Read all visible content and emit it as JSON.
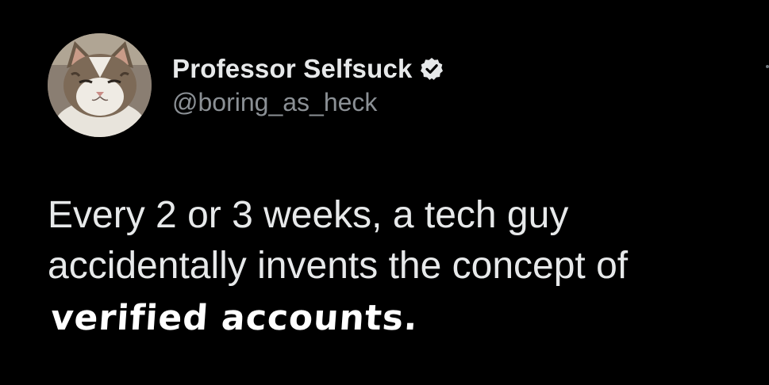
{
  "tweet": {
    "author": {
      "display_name": "Professor Selfsuck",
      "handle": "@boring_as_heck",
      "verified": true,
      "avatar_icon": "cat-avatar"
    },
    "text_lines": [
      "Every 2 or 3 weeks, a tech guy",
      "accidentally invents the concept of"
    ],
    "overlay_text": "verified accounts.",
    "more_icon": "more-options-icon"
  },
  "colors": {
    "background": "#000000",
    "primary_text": "#e7e9ea",
    "secondary_text": "#8b9095"
  }
}
